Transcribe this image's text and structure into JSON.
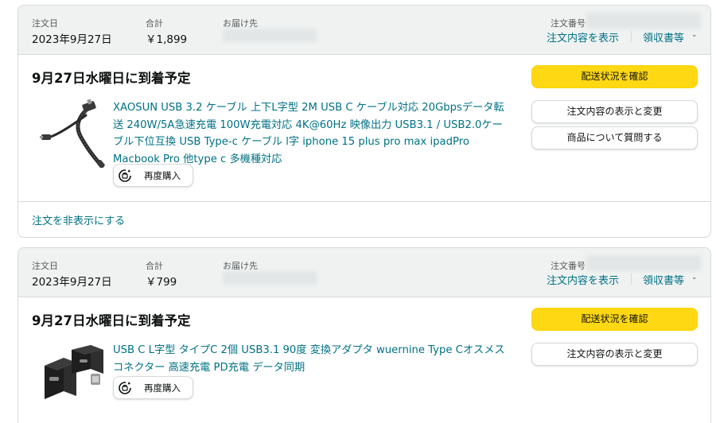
{
  "orders": [
    {
      "order_date_label": "注文日",
      "order_date": "2023年9月27日",
      "total_label": "合計",
      "total": "￥1,899",
      "ship_to_label": "お届け先",
      "order_number_label": "注文番号",
      "view_details_link": "注文内容を表示",
      "receipt_link": "領収書等",
      "delivery_status": "9月27日水曜日に到着予定",
      "product_title": "XAOSUN USB 3.2 ケーブル 上下L字型 2M USB C ケーブル対応 20Gbpsデータ転送 240W/5A急速充電 100W充電対応 4K@60Hz 映像出力 USB3.1 / USB2.0ケーブル下位互換 USB Type-c ケーブル l字 iphone 15 plus pro max ipadPro Macbook Pro 他type c 多機種対応",
      "rebuy_label": "再度購入",
      "track_button": "配送状況を確認",
      "view_edit_button": "注文内容の表示と変更",
      "ask_question_button": "商品について質問する",
      "hide_order_link": "注文を非表示にする"
    },
    {
      "order_date_label": "注文日",
      "order_date": "2023年9月27日",
      "total_label": "合計",
      "total": "￥799",
      "ship_to_label": "お届け先",
      "order_number_label": "注文番号",
      "view_details_link": "注文内容を表示",
      "receipt_link": "領収書等",
      "delivery_status": "9月27日水曜日に到着予定",
      "product_title": "USB C L字型 タイプC 2個 USB3.1 90度 変換アダプタ wuernine Type Cオスメスコネクター 高速充電 PD充電 データ同期",
      "rebuy_label": "再度購入",
      "track_button": "配送状況を確認",
      "view_edit_button": "注文内容の表示と変更"
    }
  ],
  "colors": {
    "link": "#007185",
    "header_bg": "#f0f2f2",
    "border": "#d5d9d9",
    "primary_button": "#ffd814",
    "text": "#0f1111",
    "muted": "#565959"
  },
  "icons": {
    "caret": "chevron-down-icon",
    "rebuy": "rebuy-icon"
  }
}
